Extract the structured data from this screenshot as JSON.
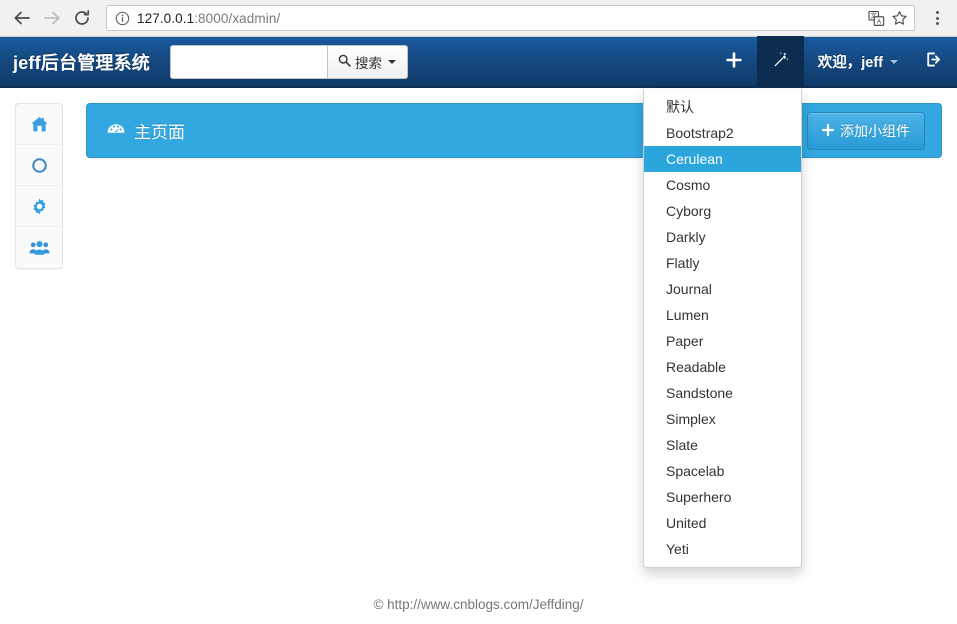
{
  "browser": {
    "back_icon": "back-arrow-icon",
    "forward_icon": "forward-arrow-icon",
    "reload_icon": "reload-icon",
    "info_icon": "page-info-icon",
    "url_scheme": "127.0.0.1",
    "url_rest": ":8000/xadmin/",
    "url_full": "127.0.0.1:8000/xadmin/",
    "translate_icon": "translate-icon",
    "bookmark_icon": "star-icon",
    "menu_icon": "three-dot-menu-icon"
  },
  "navbar": {
    "brand": "jeff后台管理系统",
    "search": {
      "value": "",
      "placeholder": "",
      "button_label": "搜索",
      "icon": "search-icon"
    },
    "add_icon": "plus-icon",
    "theme_icon": "magic-wand-icon",
    "welcome_label": "欢迎，jeff",
    "logout_icon": "logout-icon"
  },
  "sidebar": {
    "items": [
      {
        "icon": "home-icon",
        "name": "sidebar-item-home"
      },
      {
        "icon": "circle-icon",
        "name": "sidebar-item-circle"
      },
      {
        "icon": "gear-icon",
        "name": "sidebar-item-settings"
      },
      {
        "icon": "users-icon",
        "name": "sidebar-item-users"
      }
    ]
  },
  "panel": {
    "title": "主页面",
    "title_icon": "dashboard-icon",
    "add_widget_label": "添加小组件",
    "add_widget_icon": "plus-icon"
  },
  "theme_dropdown": {
    "open": true,
    "selected": "Cerulean",
    "items": [
      "默认",
      "Bootstrap2",
      "Cerulean",
      "Cosmo",
      "Cyborg",
      "Darkly",
      "Flatly",
      "Journal",
      "Lumen",
      "Paper",
      "Readable",
      "Sandstone",
      "Simplex",
      "Slate",
      "Spacelab",
      "Superhero",
      "United",
      "Yeti"
    ]
  },
  "footer": {
    "text": "© http://www.cnblogs.com/Jeffding/"
  },
  "colors": {
    "navbar_dark_blue": "#14467c",
    "panel_blue": "#33a7e0",
    "highlight_blue": "#2ba6dd",
    "sidebar_icon_blue": "#3a9fe0"
  }
}
